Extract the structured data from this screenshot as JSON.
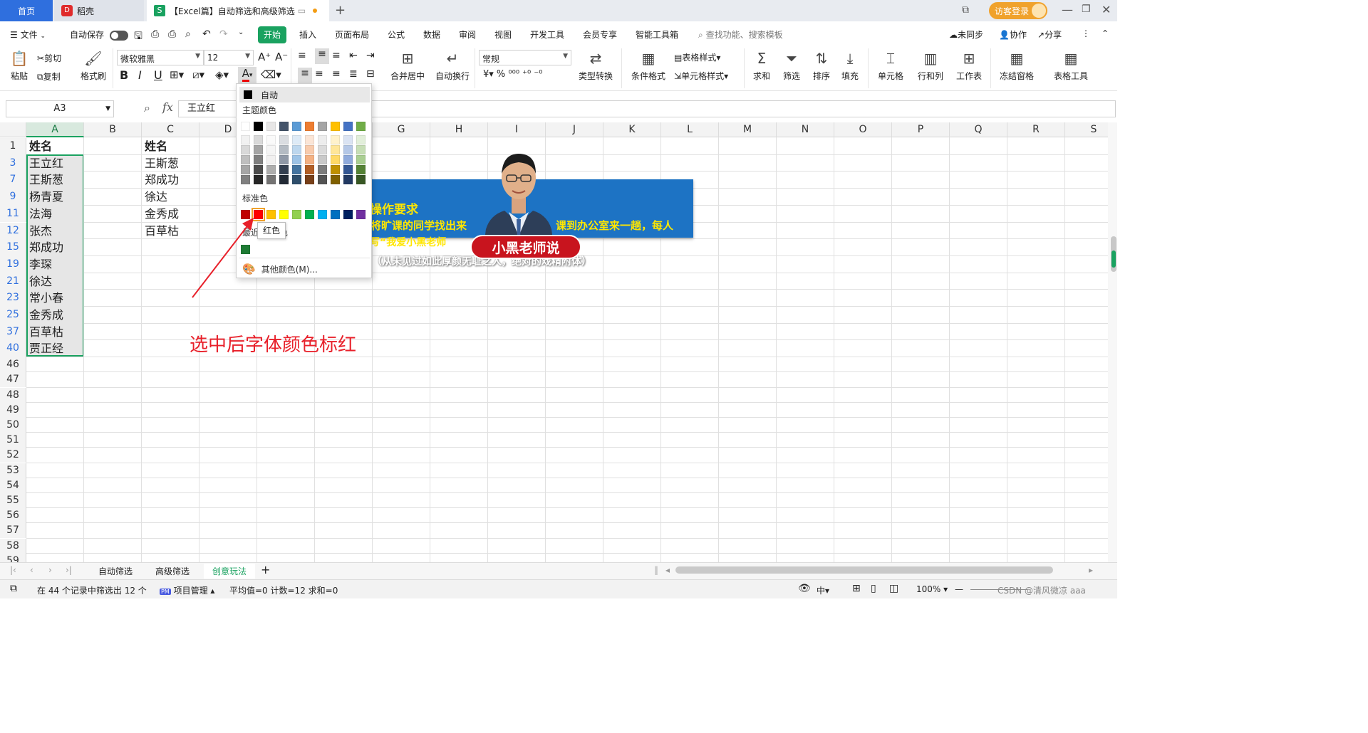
{
  "titlebar": {
    "tabs": [
      "首页",
      "稻壳",
      "【Excel篇】自动筛选和高级筛选"
    ],
    "login": "访客登录"
  },
  "menu": {
    "file": "文件",
    "autosave": "自动保存",
    "tabs": [
      "开始",
      "插入",
      "页面布局",
      "公式",
      "数据",
      "审阅",
      "视图",
      "开发工具",
      "会员专享",
      "智能工具箱"
    ],
    "search": "查找功能、搜索模板",
    "right": [
      "未同步",
      "协作",
      "分享"
    ]
  },
  "ribbon": {
    "paste": "粘贴",
    "cut": "剪切",
    "copy": "复制",
    "format_painter": "格式刷",
    "font_name": "微软雅黑",
    "font_size": "12",
    "merge": "合并居中",
    "wrap": "自动换行",
    "number_format": "常规",
    "type_convert": "类型转换",
    "cond_format": "条件格式",
    "table_style": "表格样式",
    "cell_style": "单元格样式",
    "sum": "求和",
    "filter": "筛选",
    "sort": "排序",
    "fill": "填充",
    "cell": "单元格",
    "row_col": "行和列",
    "worksheet": "工作表",
    "freeze": "冻结窗格",
    "table_tools": "表格工具"
  },
  "formula_bar": {
    "name_box": "A3",
    "fx": "fx",
    "value": "王立红"
  },
  "columns": [
    "A",
    "B",
    "C",
    "D",
    "E",
    "F",
    "G",
    "H",
    "I",
    "J",
    "K",
    "L",
    "M",
    "N",
    "O",
    "P",
    "Q",
    "R",
    "S"
  ],
  "rows": [
    {
      "num": "1",
      "a": "姓名",
      "c": "姓名",
      "bold": true
    },
    {
      "num": "3",
      "a": "王立红",
      "c": "王斯葱"
    },
    {
      "num": "7",
      "a": "王斯葱",
      "c": "郑成功"
    },
    {
      "num": "9",
      "a": "杨青夏",
      "c": "徐达"
    },
    {
      "num": "11",
      "a": "法海",
      "c": "金秀成"
    },
    {
      "num": "12",
      "a": "张杰",
      "c": "百草枯"
    },
    {
      "num": "15",
      "a": "郑成功",
      "c": ""
    },
    {
      "num": "19",
      "a": "李琛",
      "c": ""
    },
    {
      "num": "21",
      "a": "徐达",
      "c": ""
    },
    {
      "num": "23",
      "a": "常小春",
      "c": ""
    },
    {
      "num": "25",
      "a": "金秀成",
      "c": ""
    },
    {
      "num": "37",
      "a": "百草枯",
      "c": ""
    },
    {
      "num": "40",
      "a": "贾正经",
      "c": ""
    },
    {
      "num": "46",
      "a": "",
      "c": ""
    },
    {
      "num": "47",
      "a": "",
      "c": ""
    },
    {
      "num": "48",
      "a": "",
      "c": ""
    },
    {
      "num": "49",
      "a": "",
      "c": ""
    },
    {
      "num": "50",
      "a": "",
      "c": ""
    },
    {
      "num": "51",
      "a": "",
      "c": ""
    },
    {
      "num": "52",
      "a": "",
      "c": ""
    },
    {
      "num": "53",
      "a": "",
      "c": ""
    },
    {
      "num": "54",
      "a": "",
      "c": ""
    },
    {
      "num": "55",
      "a": "",
      "c": ""
    },
    {
      "num": "56",
      "a": "",
      "c": ""
    },
    {
      "num": "57",
      "a": "",
      "c": ""
    },
    {
      "num": "58",
      "a": "",
      "c": ""
    },
    {
      "num": "59",
      "a": "",
      "c": ""
    }
  ],
  "color_dropdown": {
    "auto": "自动",
    "theme_label": "主题颜色",
    "standard_label": "标准色",
    "recent_label_left": "最近",
    "recent_label_right": "色",
    "more": "其他颜色(M)...",
    "tooltip": "红色",
    "theme_top": [
      "#ffffff",
      "#000000",
      "#e7e6e6",
      "#44546a",
      "#5b9bd5",
      "#ed7d31",
      "#a5a5a5",
      "#ffc000",
      "#4472c4",
      "#70ad47"
    ],
    "standard": [
      "#c00000",
      "#ff0000",
      "#ffc000",
      "#ffff00",
      "#92d050",
      "#00b050",
      "#00b0f0",
      "#0070c0",
      "#002060",
      "#7030a0"
    ],
    "recent": [
      "#1e7b34"
    ]
  },
  "banner": {
    "title": "操作要求",
    "line1a": "非将旷课的同学找出来",
    "line1b": "课到办公室来一趟，每人",
    "line2": "抄写“我爱小黑老师",
    "sub": "（从未见过如此厚颜无耻之人，绝对的戏精附体）",
    "badge": "小黑老师说"
  },
  "annotation": "选中后字体颜色标红",
  "sheets": [
    "自动筛选",
    "高级筛选",
    "创意玩法"
  ],
  "status": {
    "filter_info": "在 44 个记录中筛选出 12 个",
    "project": "项目管理",
    "stats": "平均值=0  计数=12  求和=0",
    "zoom": "100%",
    "watermark": "CSDN @清风微凉 aaa"
  }
}
